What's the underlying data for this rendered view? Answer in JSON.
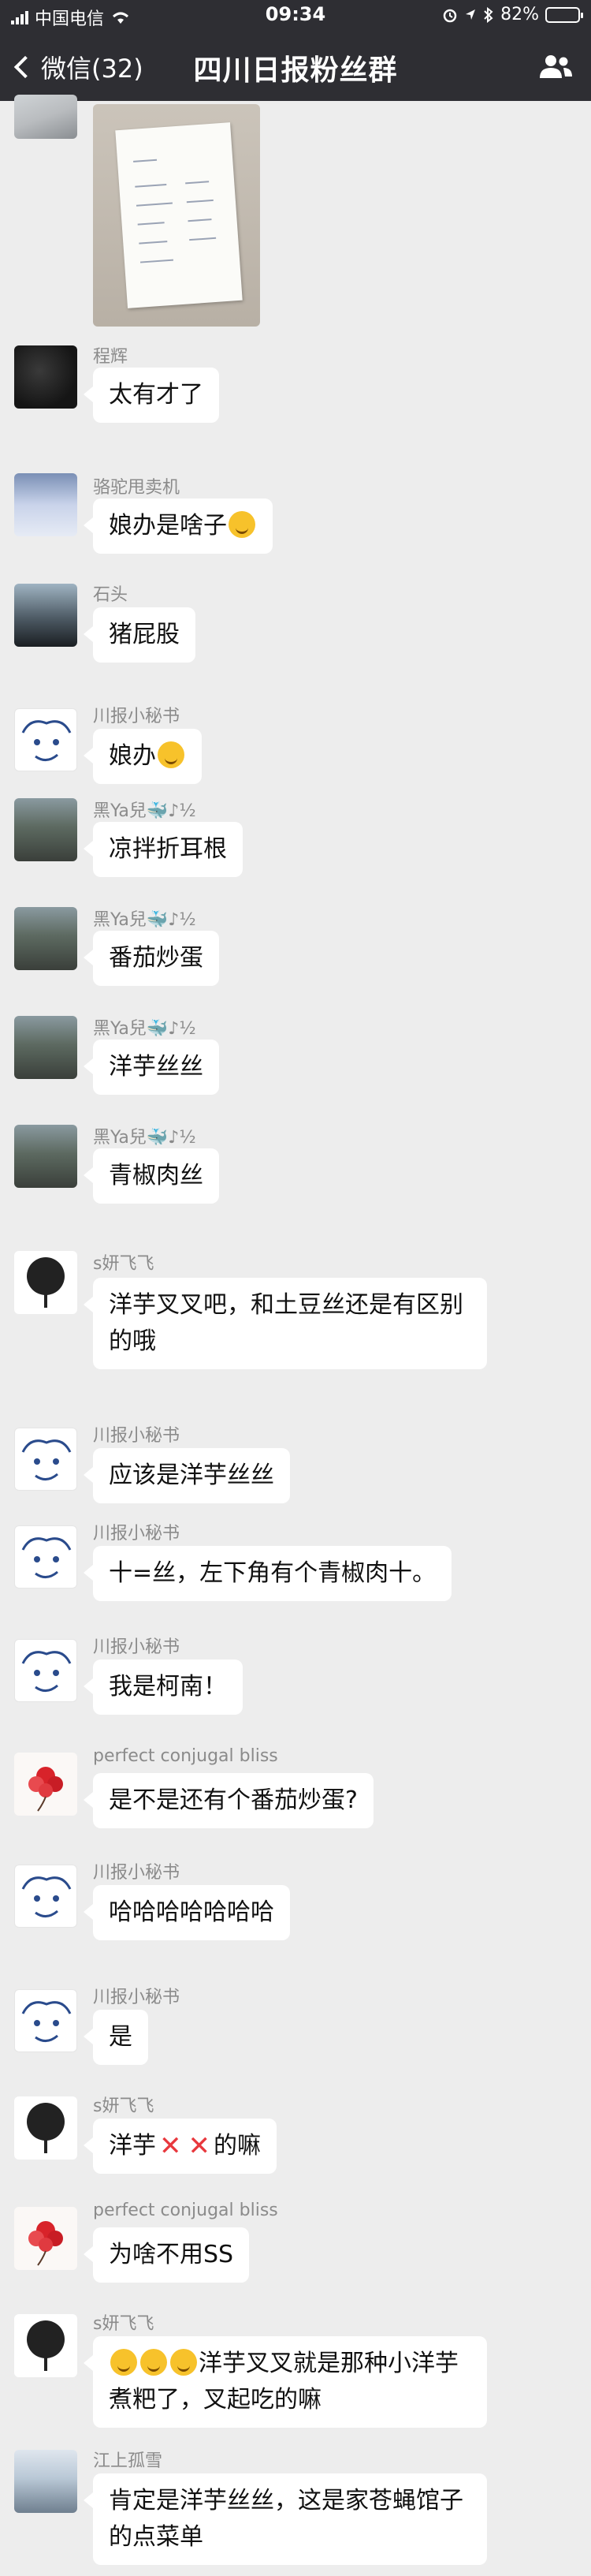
{
  "status_bar": {
    "carrier": "中国电信",
    "time": "09:34",
    "battery": "82%",
    "battery_level": 0.82
  },
  "nav": {
    "back_label": "微信(32)",
    "title": "四川日报粉丝群",
    "members_icon": "group-members-icon"
  },
  "messages": [
    {
      "sender": "",
      "text": "",
      "avatar": "cat",
      "type": "image"
    },
    {
      "sender": "程辉",
      "text": "太有才了",
      "avatar": "dark"
    },
    {
      "sender": "骆驼甩卖机",
      "text": "娘办是啥子",
      "avatar": "swan",
      "emoji_after": true
    },
    {
      "sender": "石头",
      "text": "猪屁股",
      "avatar": "car"
    },
    {
      "sender": "川报小秘书",
      "text": "娘办",
      "avatar": "sketch",
      "emoji_after": true
    },
    {
      "sender": "黑Ya兒🐳♪½",
      "text": "凉拌折耳根",
      "avatar": "street"
    },
    {
      "sender": "黑Ya兒🐳♪½",
      "text": "番茄炒蛋",
      "avatar": "street"
    },
    {
      "sender": "黑Ya兒🐳♪½",
      "text": "洋芋丝丝",
      "avatar": "street"
    },
    {
      "sender": "黑Ya兒🐳♪½",
      "text": "青椒肉丝",
      "avatar": "street"
    },
    {
      "sender": "s妍飞飞",
      "text": "洋芋叉叉吧，和土豆丝还是有区别的哦",
      "avatar": "tree"
    },
    {
      "sender": "川报小秘书",
      "text": "应该是洋芋丝丝",
      "avatar": "sketch"
    },
    {
      "sender": "川报小秘书",
      "text": "十=丝，左下角有个青椒肉十。",
      "avatar": "sketch"
    },
    {
      "sender": "川报小秘书",
      "text": "我是柯南！",
      "avatar": "sketch"
    },
    {
      "sender": "perfect conjugal bliss",
      "text": "是不是还有个番茄炒蛋?",
      "avatar": "flower"
    },
    {
      "sender": "川报小秘书",
      "text": "哈哈哈哈哈哈哈",
      "avatar": "sketch"
    },
    {
      "sender": "川报小秘书",
      "text": "是",
      "avatar": "sketch"
    },
    {
      "sender": "s妍飞飞",
      "text_pre": "洋芋",
      "text_post": "的嘛",
      "avatar": "tree",
      "xmarks": true
    },
    {
      "sender": "perfect conjugal bliss",
      "text": "为啥不用SS",
      "avatar": "flower"
    },
    {
      "sender": "s妍飞飞",
      "text": "洋芋叉叉就是那种小洋芋煮粑了，叉起吃的嘛",
      "avatar": "tree",
      "emoji_before": 3
    },
    {
      "sender": "江上孤雪",
      "text": "肯定是洋芋丝丝，这是家苍蝇馆子的点菜单",
      "avatar": "lake"
    }
  ]
}
